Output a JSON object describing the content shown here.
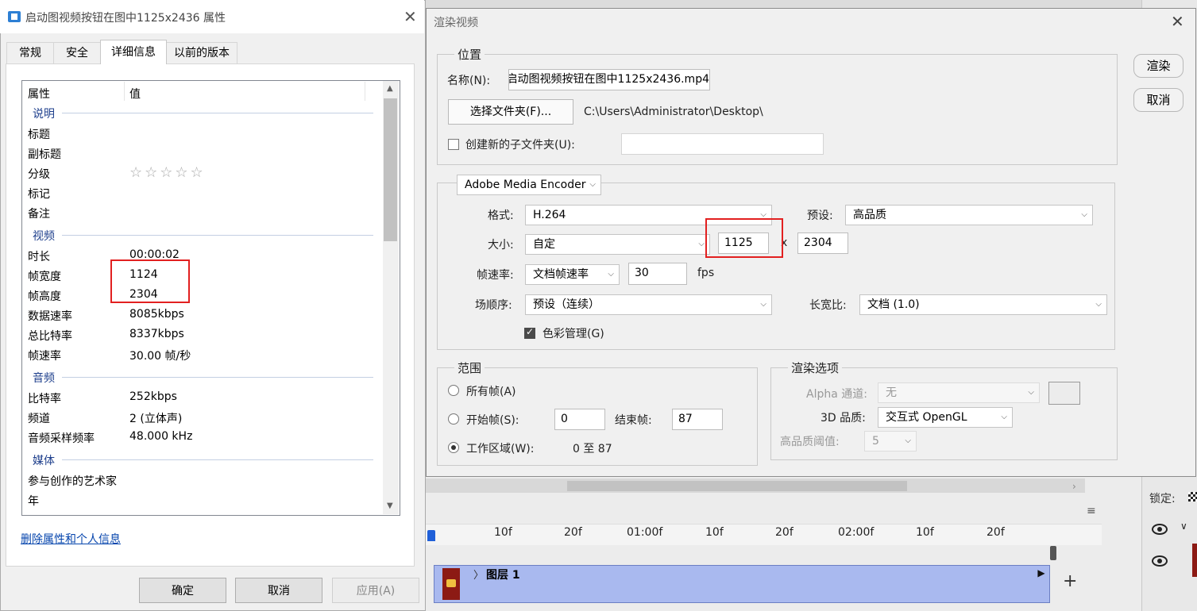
{
  "properties_dialog": {
    "title": "启动图视频按钮在图中1125x2436 属性",
    "tabs": [
      "常规",
      "安全",
      "详细信息",
      "以前的版本"
    ],
    "active_tab": "详细信息",
    "columns": {
      "property": "属性",
      "value": "值"
    },
    "groups": {
      "description": {
        "label": "说明",
        "rows": [
          {
            "name": "标题",
            "value": ""
          },
          {
            "name": "副标题",
            "value": ""
          },
          {
            "name": "分级",
            "value": "☆☆☆☆☆"
          },
          {
            "name": "标记",
            "value": ""
          },
          {
            "name": "备注",
            "value": ""
          }
        ]
      },
      "video": {
        "label": "视频",
        "rows": [
          {
            "name": "时长",
            "value": "00:00:02"
          },
          {
            "name": "帧宽度",
            "value": "1124"
          },
          {
            "name": "帧高度",
            "value": "2304"
          },
          {
            "name": "数据速率",
            "value": "8085kbps"
          },
          {
            "name": "总比特率",
            "value": "8337kbps"
          },
          {
            "name": "帧速率",
            "value": "30.00 帧/秒"
          }
        ]
      },
      "audio": {
        "label": "音频",
        "rows": [
          {
            "name": "比特率",
            "value": "252kbps"
          },
          {
            "name": "频道",
            "value": "2 (立体声)"
          },
          {
            "name": "音频采样频率",
            "value": "48.000 kHz"
          }
        ]
      },
      "media": {
        "label": "媒体",
        "rows": [
          {
            "name": "参与创作的艺术家",
            "value": ""
          },
          {
            "name": "年",
            "value": ""
          }
        ]
      }
    },
    "remove_link": "删除属性和个人信息",
    "buttons": {
      "ok": "确定",
      "cancel": "取消",
      "apply": "应用(A)"
    }
  },
  "render_dialog": {
    "title": "渲染视频",
    "location_legend": "位置",
    "name_label": "名称(N):",
    "name_value": "启动图视频按钮在图中1125x2436.mp4",
    "choose_folder": "选择文件夹(F)...",
    "folder_path": "C:\\Users\\Administrator\\Desktop\\",
    "subfolder_label": "创建新的子文件夹(U):",
    "subfolder_checked": false,
    "subfolder_value": "",
    "encoder": "Adobe Media Encoder",
    "format_label": "格式:",
    "format_value": "H.264",
    "preset_label": "预设:",
    "preset_value": "高品质",
    "size_label": "大小:",
    "size_value": "自定",
    "width": "1125",
    "times": "x",
    "height": "2304",
    "fps_label": "帧速率:",
    "fps_mode": "文档帧速率",
    "fps_value": "30",
    "fps_unit": "fps",
    "field_order_label": "场顺序:",
    "field_order_value": "预设（连续）",
    "aspect_label": "长宽比:",
    "aspect_value": "文档 (1.0)",
    "color_mgmt_label": "色彩管理(G)",
    "color_mgmt_checked": true,
    "range_legend": "范围",
    "all_frames": "所有帧(A)",
    "start_frame_label": "开始帧(S):",
    "start_frame_value": "0",
    "end_frame_label": "结束帧:",
    "end_frame_value": "87",
    "work_area_label": "工作区域(W):",
    "work_area_value": "0 至 87",
    "range_selected": "work_area",
    "render_options_legend": "渲染选项",
    "alpha_label": "Alpha 通道:",
    "alpha_value": "无",
    "quality3d_label": "3D 品质:",
    "quality3d_value": "交互式 OpenGL",
    "hq_threshold_label": "高品质阈值:",
    "hq_threshold_value": "5",
    "render_button": "渲染",
    "cancel_button": "取消"
  },
  "timeline": {
    "ruler": [
      "10f",
      "20f",
      "01:00f",
      "10f",
      "20f",
      "02:00f",
      "10f",
      "20f"
    ],
    "layer_name": "图层 1",
    "lock_label": "锁定:"
  },
  "colors": {
    "highlight_box": "#e22020",
    "track_fill": "#a9b9ef",
    "link": "#0645ad",
    "group_heading": "#1e3f8c"
  }
}
